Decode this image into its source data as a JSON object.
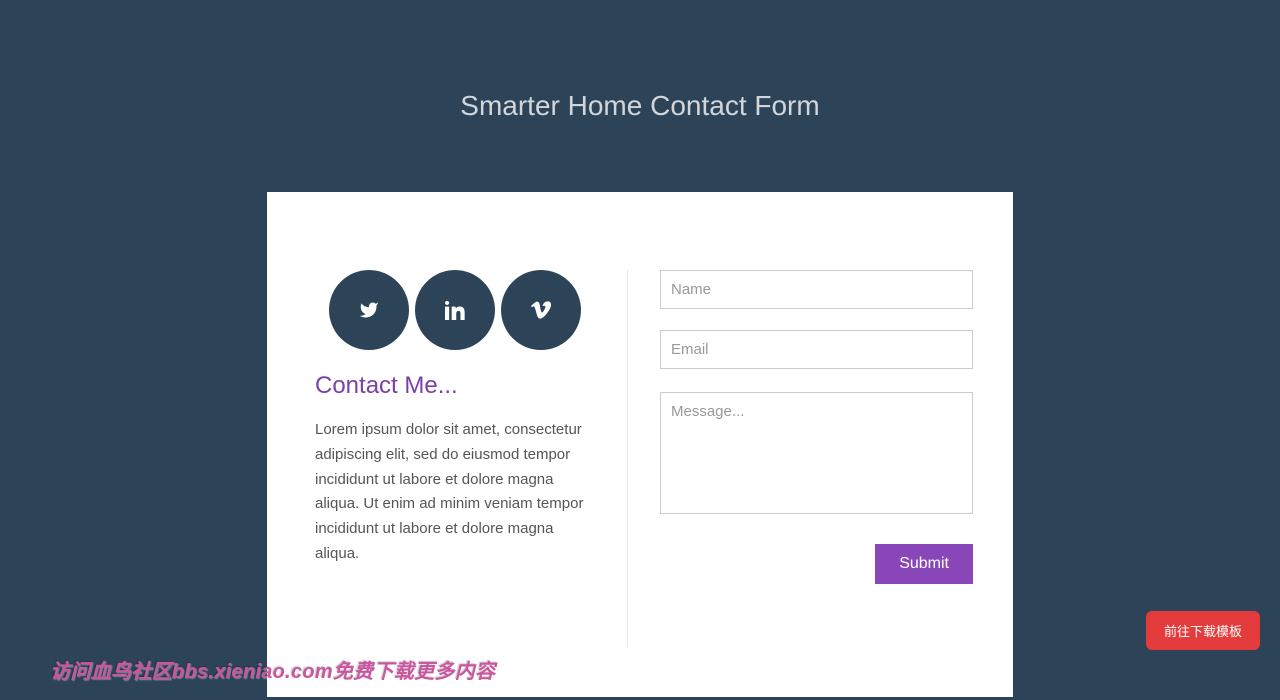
{
  "page": {
    "title": "Smarter Home Contact Form"
  },
  "left": {
    "heading": "Contact Me...",
    "text": "Lorem ipsum dolor sit amet, consectetur adipiscing elit, sed do eiusmod tempor incididunt ut labore et dolore magna aliqua. Ut enim ad minim veniam tempor incididunt ut labore et dolore magna aliqua.",
    "social": [
      "twitter",
      "linkedin",
      "vimeo"
    ]
  },
  "form": {
    "name_placeholder": "Name",
    "email_placeholder": "Email",
    "message_placeholder": "Message...",
    "submit_label": "Submit"
  },
  "badge": {
    "download_label": "前往下载模板"
  },
  "watermark": {
    "text": "访问血鸟社区bbs.xieniao.com免费下载更多内容"
  },
  "colors": {
    "bg": "#2d4458",
    "accent": "#8946b8",
    "heading": "#7b3fa9",
    "badge": "#e43c3c"
  }
}
